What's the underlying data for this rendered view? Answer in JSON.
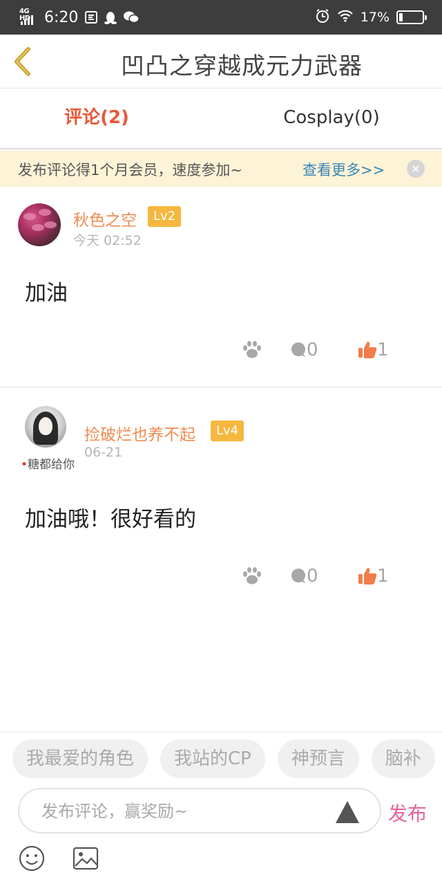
{
  "status_bar": {
    "network": "4G HD",
    "time": "6:20",
    "battery_percent": "17%",
    "battery_level": 0.17
  },
  "header": {
    "title": "凹凸之穿越成元力武器"
  },
  "tabs": [
    {
      "label": "评论(2)",
      "active": true
    },
    {
      "label": "Cosplay(0)",
      "active": false
    }
  ],
  "banner": {
    "message": "发布评论得1个月会员，速度参加~",
    "more_link": "查看更多>>",
    "close_glyph": "×"
  },
  "comments": [
    {
      "username": "秋色之空",
      "level": "Lv2",
      "time": "今天 02:52",
      "text": "加油",
      "reply_count": "0",
      "like_count": "1"
    },
    {
      "username": "捡破烂也养不起",
      "level": "Lv4",
      "avatar_tag": "糖都给你",
      "time": "06-21",
      "text": "加油哦！很好看的",
      "reply_count": "0",
      "like_count": "1"
    }
  ],
  "quick_tags": [
    "我最爱的角色",
    "我站的CP",
    "神预言",
    "脑补"
  ],
  "composer": {
    "placeholder": "发布评论，赢奖励~",
    "publish_label": "发布"
  },
  "colors": {
    "accent_orange": "#e8573a",
    "username_orange": "#f08b50",
    "level_badge": "#f5b73e",
    "link_blue": "#3a85b5",
    "publish_pink": "#e8629a",
    "banner_bg": "#fdf3d6"
  }
}
